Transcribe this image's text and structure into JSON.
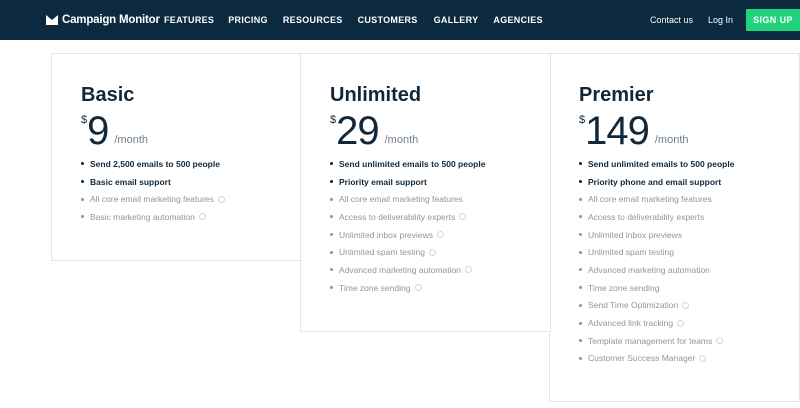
{
  "header": {
    "brand": "Campaign Monitor",
    "nav": [
      "FEATURES",
      "PRICING",
      "RESOURCES",
      "CUSTOMERS",
      "GALLERY",
      "AGENCIES"
    ],
    "contact_label": "Contact us",
    "login_label": "Log In",
    "signup_label": "SIGN UP"
  },
  "colors": {
    "header_bg": "#0b2a3f",
    "accent_green": "#21d37c",
    "heading_text": "#12283a",
    "muted_text": "#8a97a2"
  },
  "plans": [
    {
      "name": "Basic",
      "currency": "$",
      "amount": "9",
      "period": "/month",
      "features": [
        {
          "text": "Send 2,500 emails to 500 people",
          "strong": true,
          "info": false
        },
        {
          "text": "Basic email support",
          "strong": true,
          "info": false
        },
        {
          "text": "All core email marketing features",
          "strong": false,
          "info": true
        },
        {
          "text": "Basic marketing automation",
          "strong": false,
          "info": true
        }
      ]
    },
    {
      "name": "Unlimited",
      "currency": "$",
      "amount": "29",
      "period": "/month",
      "features": [
        {
          "text": "Send unlimited emails to 500 people",
          "strong": true,
          "info": false
        },
        {
          "text": "Priority email support",
          "strong": true,
          "info": false
        },
        {
          "text": "All core email marketing features",
          "strong": false,
          "info": false
        },
        {
          "text": "Access to deliverability experts",
          "strong": false,
          "info": true
        },
        {
          "text": "Unlimited inbox previews",
          "strong": false,
          "info": true
        },
        {
          "text": "Unlimited spam testing",
          "strong": false,
          "info": true
        },
        {
          "text": "Advanced marketing automation",
          "strong": false,
          "info": true
        },
        {
          "text": "Time zone sending",
          "strong": false,
          "info": true
        }
      ]
    },
    {
      "name": "Premier",
      "currency": "$",
      "amount": "149",
      "period": "/month",
      "features": [
        {
          "text": "Send unlimited emails to 500 people",
          "strong": true,
          "info": false
        },
        {
          "text": "Priority phone and email support",
          "strong": true,
          "info": false
        },
        {
          "text": "All core email marketing features",
          "strong": false,
          "info": false
        },
        {
          "text": "Access to deliverability experts",
          "strong": false,
          "info": false
        },
        {
          "text": "Unlimited inbox previews",
          "strong": false,
          "info": false
        },
        {
          "text": "Unlimited spam testing",
          "strong": false,
          "info": false
        },
        {
          "text": "Advanced marketing automation",
          "strong": false,
          "info": false
        },
        {
          "text": "Time zone sending",
          "strong": false,
          "info": false
        },
        {
          "text": "Send Time Optimization",
          "strong": false,
          "info": true
        },
        {
          "text": "Advanced link tracking",
          "strong": false,
          "info": true
        },
        {
          "text": "Template management for teams",
          "strong": false,
          "info": true
        },
        {
          "text": "Customer Success Manager",
          "strong": false,
          "info": true
        }
      ]
    }
  ]
}
